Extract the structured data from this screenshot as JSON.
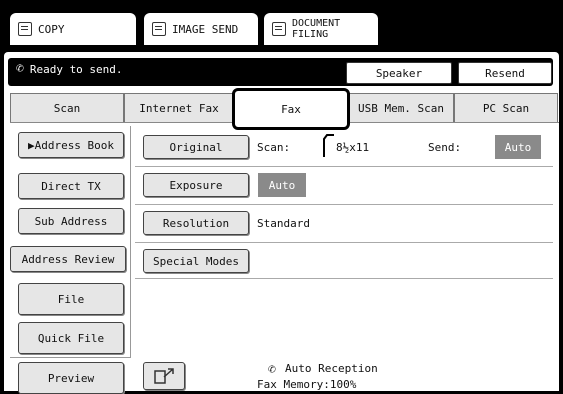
{
  "mode_tabs": {
    "copy": "COPY",
    "image_send": "IMAGE SEND",
    "document_filing": "DOCUMENT\nFILING"
  },
  "status": {
    "message": "Ready to send.",
    "speaker": "Speaker",
    "resend": "Resend"
  },
  "sub_tabs": [
    "Scan",
    "Internet Fax",
    "Fax",
    "USB Mem. Scan",
    "PC Scan"
  ],
  "side_buttons": {
    "address_book": "▶Address Book",
    "direct_tx": "Direct TX",
    "sub_address": "Sub Address",
    "address_review": "Address Review",
    "file": "File",
    "quick_file": "Quick File",
    "preview": "Preview"
  },
  "options": {
    "original": {
      "button": "Original",
      "scan_label": "Scan:",
      "scan_value": "8½x11",
      "send_label": "Send:",
      "send_value": "Auto"
    },
    "exposure": {
      "button": "Exposure",
      "value": "Auto"
    },
    "resolution": {
      "button": "Resolution",
      "value": "Standard"
    },
    "special_modes": {
      "button": "Special Modes"
    }
  },
  "footer": {
    "auto_reception": "Auto Reception",
    "fax_memory": "Fax Memory:100%"
  }
}
